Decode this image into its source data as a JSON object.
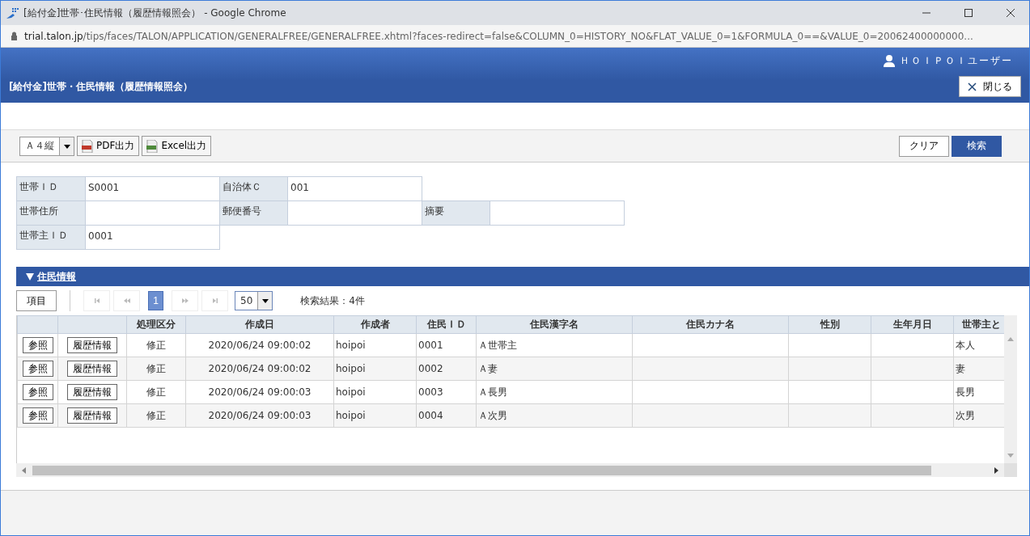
{
  "browser": {
    "title": "[給付金]世帯･住民情報（履歴情報照会） - Google Chrome",
    "url_host": "trial.talon.jp",
    "url_path": "/tips/faces/TALON/APPLICATION/GENERALFREE/GENERALFREE.xhtml?faces-redirect=false&COLUMN_0=HISTORY_NO&FLAT_VALUE_0=1&FORMULA_0==&VALUE_0=20062400000000..."
  },
  "header": {
    "user": "ＨＯＩＰＯＩユーザー",
    "title": "[給付金]世帯・住民情報（履歴情報照会）",
    "close": "閉じる"
  },
  "toolbar": {
    "paper": "Ａ４縦",
    "export_buttons": [
      {
        "kind": "pdf",
        "label": "PDF出力"
      },
      {
        "kind": "excel",
        "label": "Excel出力"
      }
    ],
    "clear": "クリア",
    "search": "検索"
  },
  "form_rows": [
    [
      {
        "label": "世帯ＩＤ",
        "value": "S0001"
      },
      {
        "label": "自治体Ｃ",
        "value": "001"
      }
    ],
    [
      {
        "label": "世帯住所"
      },
      {
        "label": "郵便番号"
      },
      {
        "label": "摘要"
      }
    ],
    [
      {
        "label": "世帯主ＩＤ",
        "value": "0001"
      }
    ]
  ],
  "section": {
    "title": "住民情報",
    "expanded": true
  },
  "pager": {
    "items_button": "項目",
    "nav": [
      {
        "kind": "first",
        "disabled": true
      },
      {
        "kind": "prev",
        "disabled": true
      },
      {
        "kind": "page",
        "label": "1",
        "selected": true
      },
      {
        "kind": "next",
        "disabled": true
      },
      {
        "kind": "last",
        "disabled": true
      }
    ],
    "page_size": "50",
    "result": "検索結果：4件"
  },
  "table": {
    "columns": [
      "",
      "",
      "処理区分",
      "作成日",
      "作成者",
      "住民ＩＤ",
      "住民漢字名",
      "住民カナ名",
      "性別",
      "生年月日",
      "世帯主と"
    ],
    "rows": [
      {
        "cells": [
          "参照",
          "履歴情報",
          "修正",
          "2020/06/24 09:00:02",
          "hoipoi",
          "0001",
          "Ａ世帯主",
          "",
          "",
          "",
          "本人"
        ]
      },
      {
        "cells": [
          "参照",
          "履歴情報",
          "修正",
          "2020/06/24 09:00:02",
          "hoipoi",
          "0002",
          "Ａ妻",
          "",
          "",
          "",
          "妻"
        ]
      },
      {
        "cells": [
          "参照",
          "履歴情報",
          "修正",
          "2020/06/24 09:00:03",
          "hoipoi",
          "0003",
          "Ａ長男",
          "",
          "",
          "",
          "長男"
        ]
      },
      {
        "cells": [
          "参照",
          "履歴情報",
          "修正",
          "2020/06/24 09:00:03",
          "hoipoi",
          "0004",
          "Ａ次男",
          "",
          "",
          "",
          "次男"
        ]
      }
    ]
  }
}
